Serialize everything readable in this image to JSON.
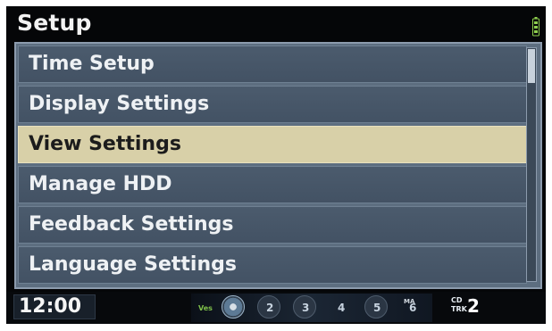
{
  "window": {
    "title": "Setup"
  },
  "status": {
    "battery_icon": "battery-icon",
    "battery_color": "#8fd04e"
  },
  "menu": {
    "items": [
      {
        "label": "Time Setup",
        "selected": false
      },
      {
        "label": "Display Settings",
        "selected": false
      },
      {
        "label": "View Settings",
        "selected": true
      },
      {
        "label": "Manage HDD",
        "selected": false
      },
      {
        "label": "Feedback Settings",
        "selected": false
      },
      {
        "label": "Language Settings",
        "selected": false
      }
    ],
    "selected_color": "#d8d0a8",
    "item_color": "#4b5b6d"
  },
  "bottom": {
    "clock": "12:00",
    "ves_label": "Ves",
    "disc_numbers": [
      "2",
      "3",
      "4",
      "5",
      "6"
    ],
    "disc_mini_label": "MA",
    "cd_label": "CD",
    "track_label": "TRK",
    "track_number": "2"
  }
}
